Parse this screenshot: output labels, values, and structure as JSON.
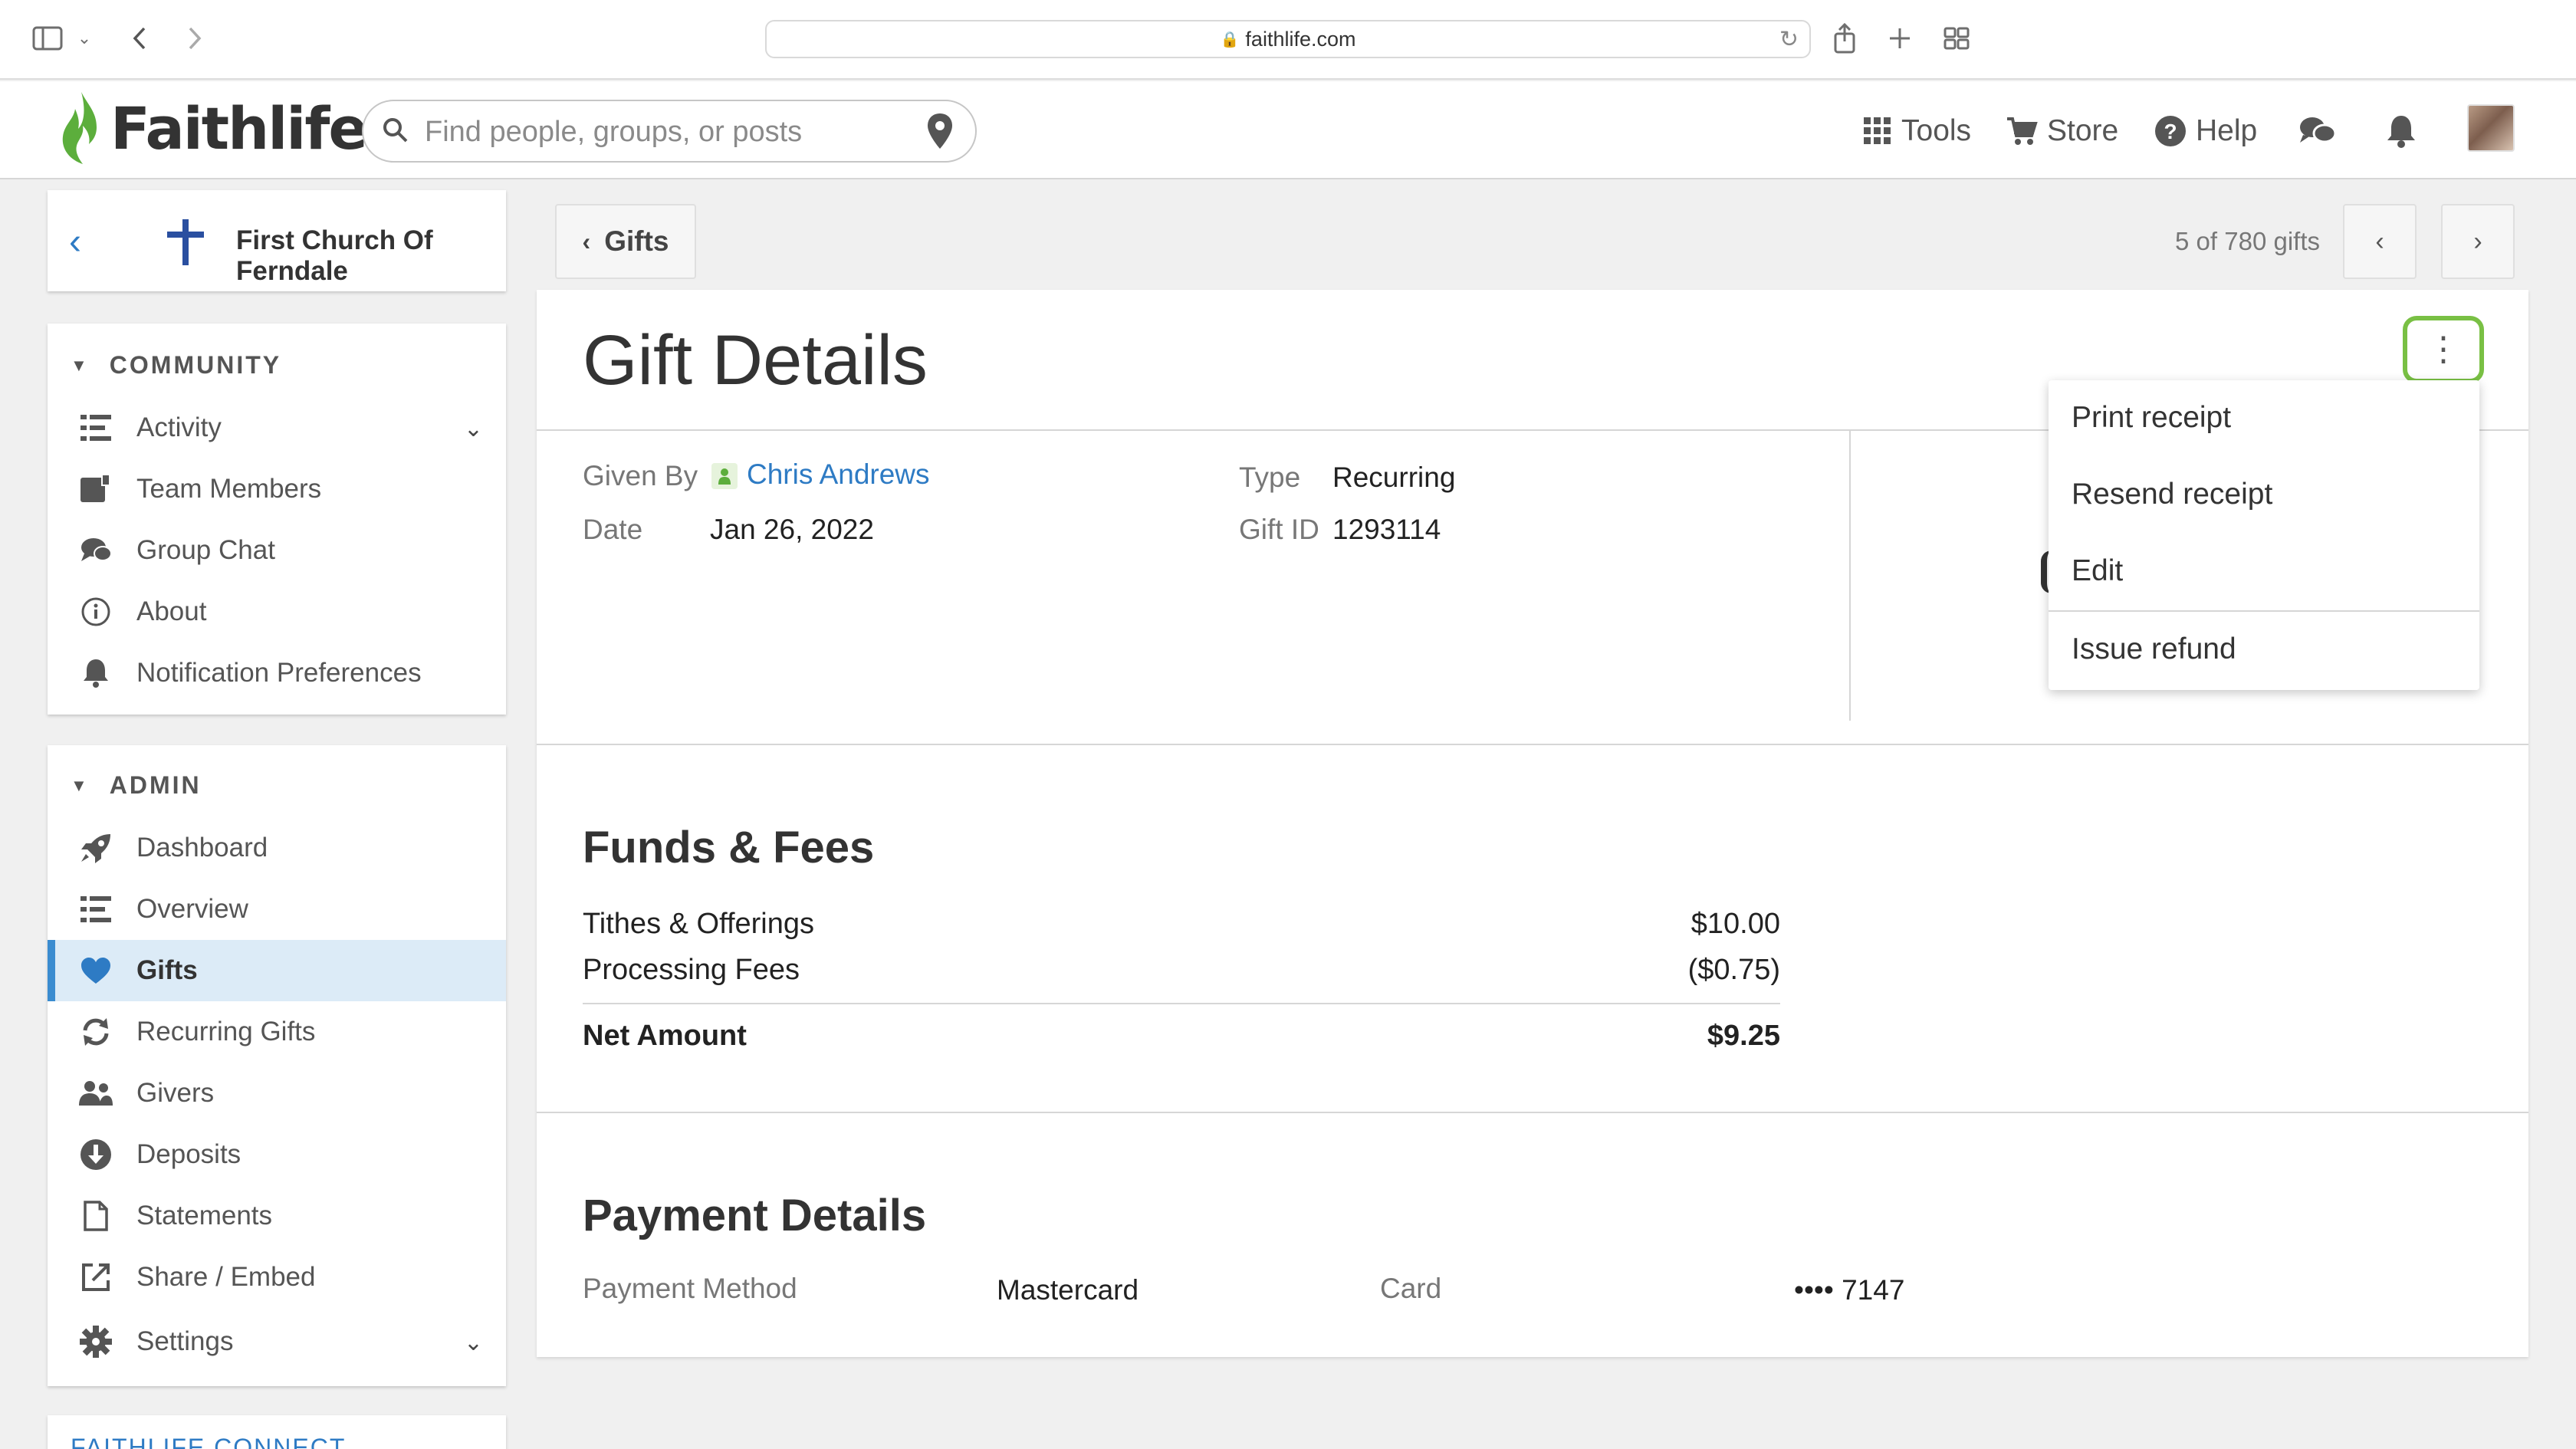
{
  "browser": {
    "url": "faithlife.com"
  },
  "header": {
    "brand": "Faithlife",
    "search_placeholder": "Find people, groups, or posts",
    "nav": {
      "tools": "Tools",
      "store": "Store",
      "help": "Help"
    }
  },
  "sidebar": {
    "church_name": "First Church Of Ferndale",
    "community": {
      "heading": "COMMUNITY",
      "items": [
        {
          "label": "Activity"
        },
        {
          "label": "Team Members"
        },
        {
          "label": "Group Chat"
        },
        {
          "label": "About"
        },
        {
          "label": "Notification Preferences"
        }
      ]
    },
    "admin": {
      "heading": "ADMIN",
      "items": [
        {
          "label": "Dashboard"
        },
        {
          "label": "Overview"
        },
        {
          "label": "Gifts"
        },
        {
          "label": "Recurring Gifts"
        },
        {
          "label": "Givers"
        },
        {
          "label": "Deposits"
        },
        {
          "label": "Statements"
        },
        {
          "label": "Share / Embed"
        },
        {
          "label": "Settings"
        }
      ]
    },
    "connect_heading": "FAITHLIFE CONNECT"
  },
  "toolbar": {
    "back_label": "Gifts",
    "pager_text": "5 of 780 gifts"
  },
  "gift": {
    "title": "Gift Details",
    "given_by_label": "Given By",
    "given_by": "Chris Andrews",
    "date_label": "Date",
    "date": "Jan 26, 2022",
    "type_label": "Type",
    "type": "Recurring",
    "gift_id_label": "Gift ID",
    "gift_id": "1293114"
  },
  "menu": {
    "items": [
      {
        "label": "Print receipt"
      },
      {
        "label": "Resend receipt"
      },
      {
        "label": "Edit"
      },
      {
        "label": "Issue refund"
      }
    ]
  },
  "funds": {
    "title": "Funds & Fees",
    "rows": [
      {
        "label": "Tithes & Offerings",
        "amount": "$10.00"
      },
      {
        "label": "Processing Fees",
        "amount": "($0.75)"
      }
    ],
    "net_label": "Net Amount",
    "net_amount": "$9.25"
  },
  "payment": {
    "title": "Payment Details",
    "method_label": "Payment Method",
    "method": "Mastercard",
    "card_label": "Card",
    "card": "•••• 7147"
  },
  "colors": {
    "brand_green": "#5cae3c",
    "link_blue": "#2e7bc4",
    "highlight_green": "#79c044",
    "active_bg": "#dcebf7"
  }
}
